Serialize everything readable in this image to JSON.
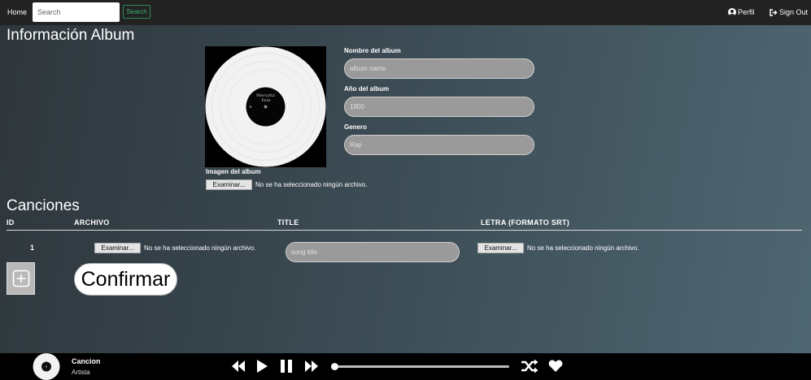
{
  "nav": {
    "home": "Home",
    "search_placeholder": "Search",
    "search_button": "Search",
    "perfil": "Perfil",
    "sign_out": "Sign Out"
  },
  "page_title": "Información Album",
  "album": {
    "image_label": "Imagen del album",
    "cover_text": "Merciful Fate",
    "file_button": "Examinar...",
    "file_status": "No se ha seleccionado ningún archivo.",
    "fields": [
      {
        "label": "Nombre del album",
        "placeholder": "album name"
      },
      {
        "label": "Año del album",
        "placeholder": "1900"
      },
      {
        "label": "Genero",
        "placeholder": "Rap"
      }
    ]
  },
  "songs": {
    "title": "Canciones",
    "columns": [
      "ID",
      "ARCHIVO",
      "TITLE",
      "LETRA (FORMATO SRT)"
    ],
    "rows": [
      {
        "id": "1",
        "file_button": "Examinar...",
        "file_status": "No se ha seleccionado ningún archivo.",
        "title_placeholder": "song title",
        "lyrics_button": "Examinar...",
        "lyrics_status": "No se ha seleccionado ningún archivo."
      }
    ],
    "add_icon": "plus-square-icon",
    "confirm": "Confirmar"
  },
  "player": {
    "song": "Cancion",
    "artist": "Artista",
    "progress": 0.02,
    "icons": [
      "rewind-icon",
      "play-icon",
      "pause-icon",
      "fast-forward-icon",
      "shuffle-icon",
      "heart-icon"
    ]
  }
}
